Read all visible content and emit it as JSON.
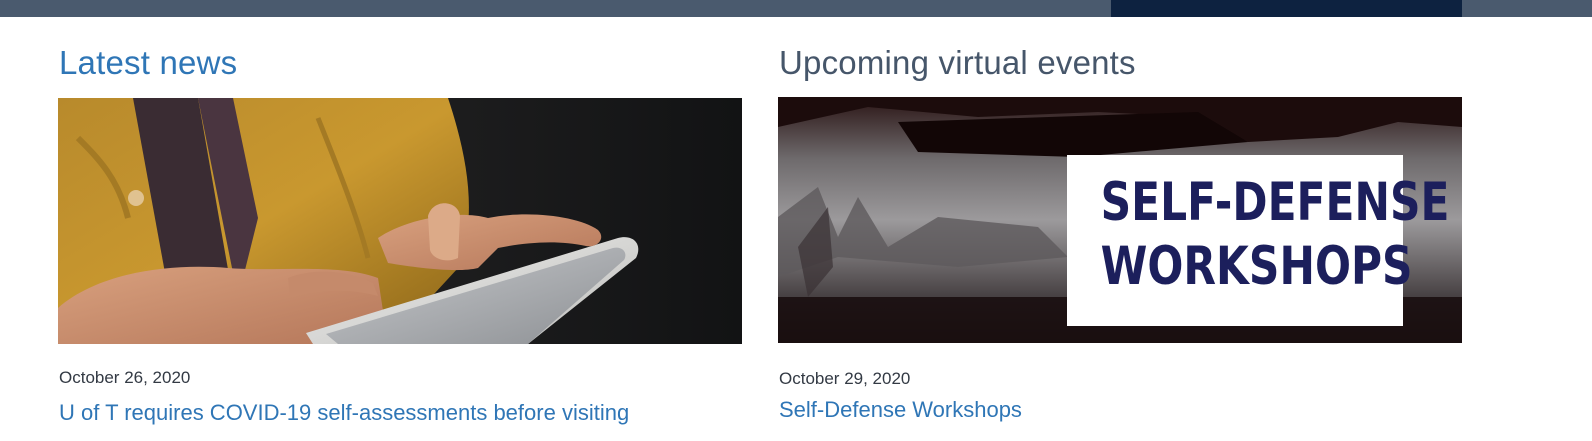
{
  "news": {
    "title": "Latest news",
    "image_alt": "Person in yellow shirt holding a smartphone",
    "date": "October 26, 2020",
    "headline": "U of T requires COVID-19 self-assessments before visiting"
  },
  "events": {
    "title": "Upcoming virtual events",
    "image_alt": "Self-Defense Workshops banner",
    "image_text_line1": "SELF-DEFENSE",
    "image_text_line2": "WORKSHOPS",
    "date": "October 29, 2020",
    "headline": "Self-Defense Workshops"
  },
  "colors": {
    "link_blue": "#2f76b6",
    "heading_slate": "#46566a",
    "top_bar": "#4a5a6e",
    "top_button": "#0d2240",
    "workshop_text": "#1c1f5c"
  }
}
